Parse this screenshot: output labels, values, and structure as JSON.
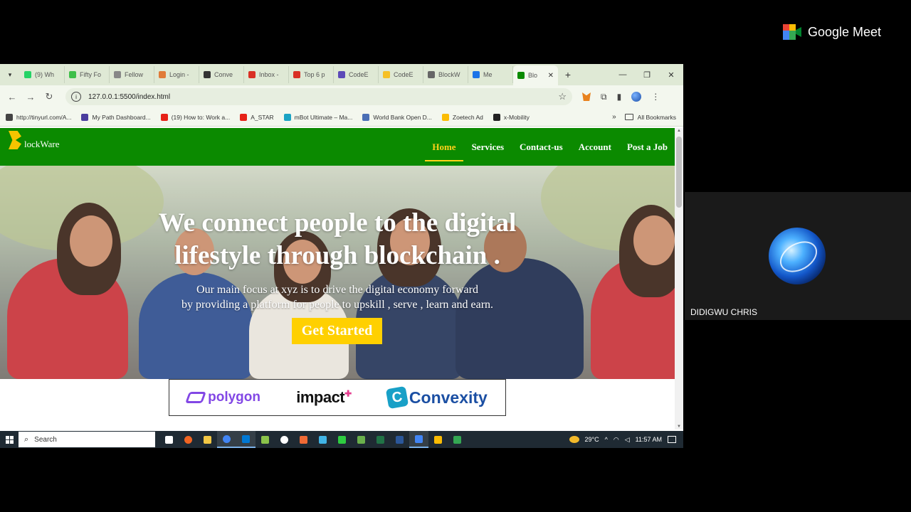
{
  "browser": {
    "tabs": [
      {
        "label": "(9) Wh",
        "color": "#25d366"
      },
      {
        "label": "Fifty Fo",
        "color": "#3fbf4a"
      },
      {
        "label": "Fellow",
        "color": "#888888"
      },
      {
        "label": "Login -",
        "color": "#e07b39"
      },
      {
        "label": "Conve",
        "color": "#333333"
      },
      {
        "label": "Inbox -",
        "color": "#d93025"
      },
      {
        "label": "Top 6 p",
        "color": "#d93025"
      },
      {
        "label": "CodeE",
        "color": "#5c4ab8"
      },
      {
        "label": "CodeE",
        "color": "#f6c026"
      },
      {
        "label": "BlockW",
        "color": "#666666"
      },
      {
        "label": "Me",
        "color": "#1a73e8"
      }
    ],
    "active_tab": {
      "label": "Blo",
      "close": "✕"
    },
    "new_tab": "+",
    "window_controls": [
      "—",
      "❐",
      "✕"
    ],
    "url": "127.0.0.1:5500/index.html",
    "bookmarks": [
      {
        "label": "http://tinyurl.com/A...",
        "color": "#444444"
      },
      {
        "label": "My Path Dashboard...",
        "color": "#4a3d9e"
      },
      {
        "label": "(19) How to: Work a...",
        "color": "#e62117"
      },
      {
        "label": "A_STAR",
        "color": "#e62117"
      },
      {
        "label": "mBot Ultimate – Ma...",
        "color": "#1aa3c4"
      },
      {
        "label": "World Bank Open D...",
        "color": "#4a6fb5"
      },
      {
        "label": "Zoetech Ad",
        "color": "#fbbc04"
      },
      {
        "label": "x-Mobility",
        "color": "#222222"
      }
    ],
    "bookmarks_more": "»",
    "all_bookmarks": "All Bookmarks"
  },
  "site": {
    "logo_text": "lockWare",
    "nav": [
      "Home",
      "Services",
      "Contact-us",
      "Account",
      "Post a Job"
    ],
    "hero_title_line1": "We connect people to the digital",
    "hero_title_line2": "lifestyle through blockchain .",
    "hero_sub_line1": "Our main focus at xyz is to drive the digital economy forward",
    "hero_sub_line2": "by providing a platform for people to upskill , serve , learn and earn.",
    "cta_label": "Get Started",
    "partners": {
      "polygon": "polygon",
      "impact": "impact",
      "convexity_mark": "C",
      "convexity": "Convexity"
    }
  },
  "taskbar": {
    "search_placeholder": "Search",
    "weather": "29°C",
    "time": "11:57 AM",
    "app_colors": [
      "#ffffff",
      "#f26522",
      "#f2c744",
      "#4285f4",
      "#0078d4",
      "#8bc34a",
      "#ffffff",
      "#f06a35",
      "#41b4e6",
      "#2ecc40",
      "#6ab04c",
      "#217346",
      "#2b579a",
      "#4285f4",
      "#fbbc04",
      "#34a853"
    ],
    "active_apps": [
      3,
      4,
      13
    ]
  },
  "meet": {
    "brand": "Google Meet",
    "participant": "DIDIGWU CHRIS"
  }
}
